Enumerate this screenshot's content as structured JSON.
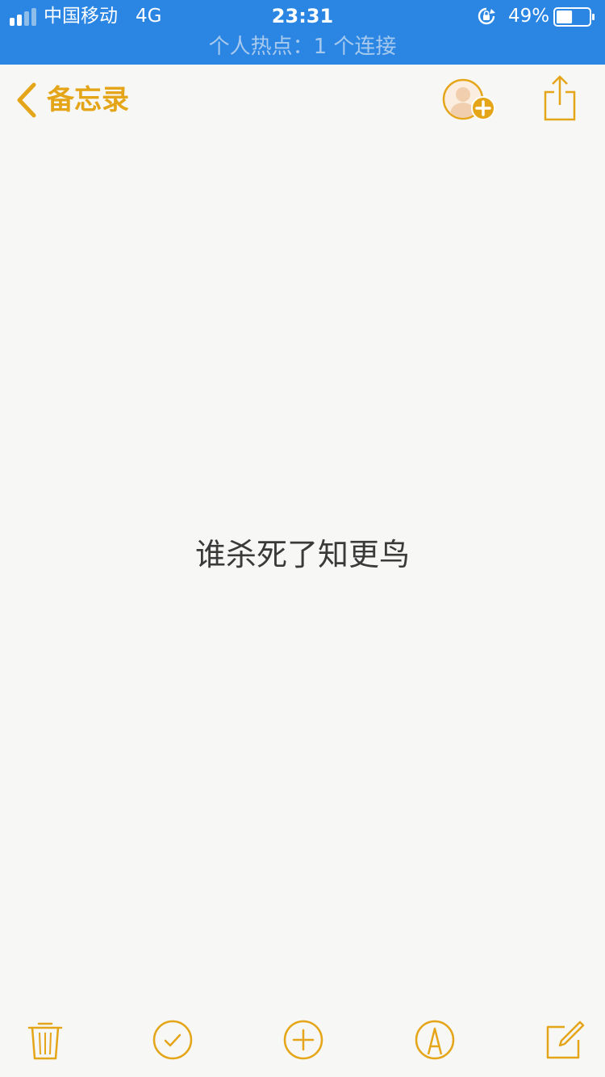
{
  "status_bar": {
    "carrier": "中国移动",
    "network": "4G",
    "time": "23:31",
    "battery_percent": "49%",
    "battery_level": 0.49,
    "hotspot_text": "个人热点：1 个连接",
    "signal_icon": "signal-bars-icon",
    "lock_icon": "rotation-lock-icon",
    "battery_icon": "battery-icon"
  },
  "nav": {
    "back_label": "备忘录",
    "back_icon": "chevron-left-icon",
    "add_person_icon": "add-person-icon",
    "share_icon": "share-icon"
  },
  "note": {
    "text": "谁杀死了知更鸟"
  },
  "toolbar": {
    "items": [
      {
        "name": "delete",
        "icon": "trash-icon"
      },
      {
        "name": "checklist",
        "icon": "checkmark-circle-icon"
      },
      {
        "name": "add",
        "icon": "plus-circle-icon"
      },
      {
        "name": "markup",
        "icon": "pen-markup-icon"
      },
      {
        "name": "compose",
        "icon": "compose-icon"
      }
    ]
  },
  "colors": {
    "accent": "#e5a519",
    "status_bar_bg": "#2b86e3",
    "paper": "#f7f7f5",
    "text": "#3a3a3a"
  }
}
